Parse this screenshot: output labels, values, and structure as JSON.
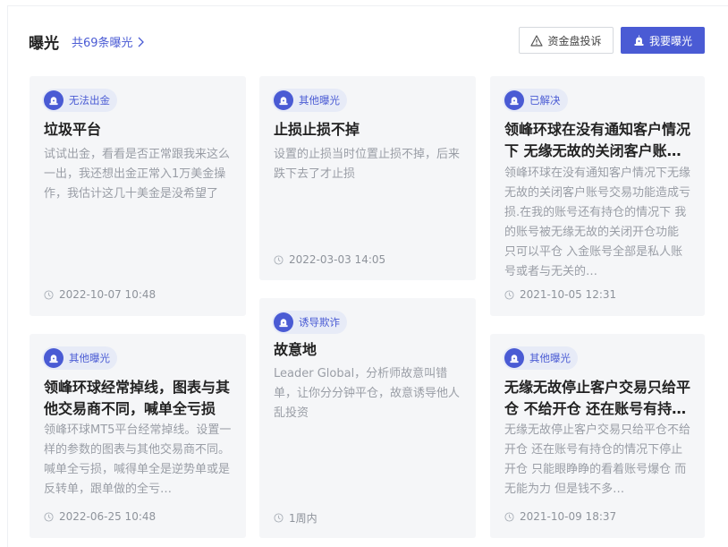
{
  "header": {
    "title": "曝光",
    "count_link": "共69条曝光",
    "complaint_button": "资金盘投诉",
    "expose_button": "我要曝光"
  },
  "cards": [
    {
      "badge": "无法出金",
      "title": "垃圾平台",
      "desc": "试试出金，看看是否正常跟我来这么一出，我还想出金正常入1万美金操作，我估计这几十美金是没希望了",
      "time": "2022-10-07 10:48"
    },
    {
      "badge": "其他曝光",
      "title": "止损止损不掉",
      "desc": "设置的止损当时位置止损不掉，后来跌下去了才止损",
      "time": "2022-03-03 14:05"
    },
    {
      "badge": "已解决",
      "title": "领峰环球在没有通知客户情况下  无缘无故的关闭客户账…",
      "desc": "领峰环球在没有通知客户情况下无缘无故的关闭客户账号交易功能造成亏损.在我的账号还有持仓的情况下  我的账号被无缘无故的关闭开仓功能  只可以平仓   入金账号全部是私人账号或者与无关的…",
      "time": "2021-10-05 12:31"
    },
    {
      "badge": "诱导欺诈",
      "title": "故意地",
      "desc": "Leader Global，分析师故意叫错单，让你分分钟平仓，故意诱导他人乱投资",
      "time": "1周内"
    },
    {
      "badge": "其他曝光",
      "title": "领峰环球经常掉线，图表与其他交易商不同，喊单全亏损",
      "desc": "领峰环球MT5平台经常掉线。设置一样的参数的图表与其他交易商不同。喊单全亏损，喊得单全是逆势单或是反转单，跟单做的全亏…",
      "time": "2022-06-25 10:48"
    },
    {
      "badge": "其他曝光",
      "title": "无缘无故停止客户交易只给平仓 不给开仓  还在账号有持…",
      "desc": "无缘无故停止客户交易只给平仓不给开仓  还在账号有持仓的情况下停止开仓  只能眼睁睁的看着账号爆仓  而无能为力  但是钱不多…",
      "time": "2021-10-09 18:37"
    }
  ]
}
